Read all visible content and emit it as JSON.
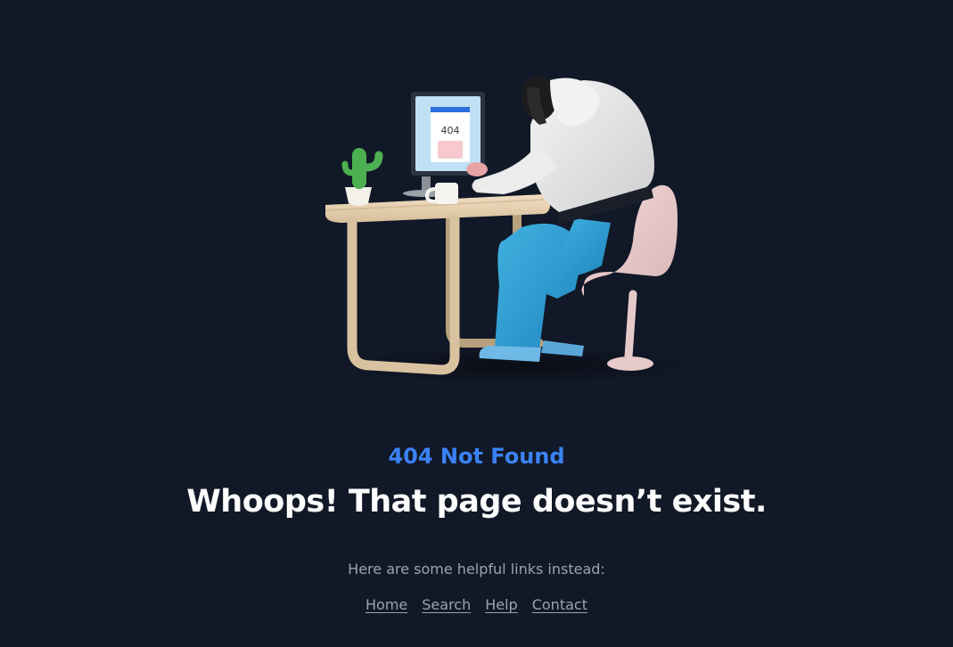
{
  "illustration": {
    "screen_text": "404"
  },
  "error": {
    "code_label": "404 Not Found",
    "headline": "Whoops! That page doesn’t exist.",
    "helper_text": "Here are some helpful links instead:"
  },
  "links": [
    {
      "label": "Home"
    },
    {
      "label": "Search"
    },
    {
      "label": "Help"
    },
    {
      "label": "Contact"
    }
  ],
  "colors": {
    "background": "#111827",
    "accent": "#3b82f6",
    "headline": "#ffffff",
    "muted": "#9ca3af"
  }
}
